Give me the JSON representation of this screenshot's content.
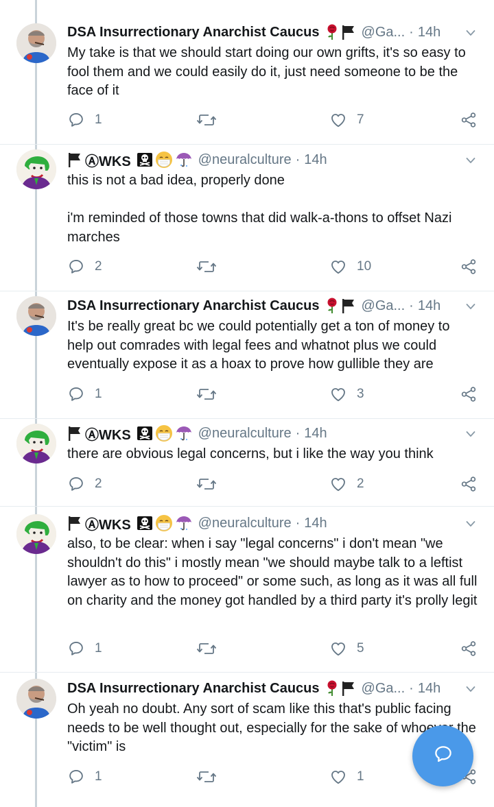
{
  "tweets": [
    {
      "avatar": "bearded-man-avatar",
      "name": "DSA Insurrectionary Anarchist Caucus",
      "emojis": [
        "rose-emoji",
        "black-flag-emoji"
      ],
      "handle": "@Ga...",
      "dot": "·",
      "time": "14h",
      "text": "My take is that we should start doing our own grifts, it's so easy to fool them and we could easily do it, just need someone to be the face of it",
      "replies": "1",
      "likes": "7"
    },
    {
      "avatar": "joker-avatar",
      "name": "ⒶWKS",
      "emojis": [
        "black-flag-emoji",
        "skull-crossbones-emoji",
        "face-mask-emoji",
        "umbrella-emoji"
      ],
      "handle": "@neuralculture",
      "dot": "·",
      "time": "14h",
      "text": "this is not a bad idea, properly done\n\ni'm reminded of those towns that did walk-a-thons to offset Nazi marches",
      "replies": "2",
      "likes": "10"
    },
    {
      "avatar": "bearded-man-avatar",
      "name": "DSA Insurrectionary Anarchist Caucus",
      "emojis": [
        "rose-emoji",
        "black-flag-emoji"
      ],
      "handle": "@Ga...",
      "dot": "·",
      "time": "14h",
      "text": "It's be really great bc we could potentially get a ton of money to help out comrades with legal fees and whatnot plus we could eventually expose it as a hoax to prove how gullible they are",
      "replies": "1",
      "likes": "3"
    },
    {
      "avatar": "joker-avatar",
      "name": "ⒶWKS",
      "emojis": [
        "black-flag-emoji",
        "skull-crossbones-emoji",
        "face-mask-emoji",
        "umbrella-emoji"
      ],
      "handle": "@neuralculture",
      "dot": "·",
      "time": "14h",
      "text": "there are obvious legal concerns, but i like the way you think",
      "replies": "2",
      "likes": "2"
    },
    {
      "avatar": "joker-avatar",
      "name": "ⒶWKS",
      "emojis": [
        "black-flag-emoji",
        "skull-crossbones-emoji",
        "face-mask-emoji",
        "umbrella-emoji"
      ],
      "handle": "@neuralculture",
      "dot": "·",
      "time": "14h",
      "text": "also, to be clear: when i say \"legal concerns\" i don't mean \"we shouldn't do this\" i mostly mean \"we should maybe talk to a leftist lawyer as to how to proceed\" or some such, as long as it was all full on charity and the money got handled by a third party it's prolly legit",
      "replies": "1",
      "likes": "5"
    },
    {
      "avatar": "bearded-man-avatar",
      "name": "DSA Insurrectionary Anarchist Caucus",
      "emojis": [
        "rose-emoji",
        "black-flag-emoji"
      ],
      "handle": "@Ga...",
      "dot": "·",
      "time": "14h",
      "text": "Oh yeah no doubt. Any sort of scam like this that's public facing needs to be well thought out, especially for the sake of whoever the \"victim\" is",
      "replies": "1",
      "likes": "1"
    }
  ],
  "fab": {
    "icon": "compose-message-icon"
  },
  "colors": {
    "text": "#14171a",
    "muted": "#657786",
    "accent": "#4a99e9",
    "thread_line": "#c9d3da"
  }
}
